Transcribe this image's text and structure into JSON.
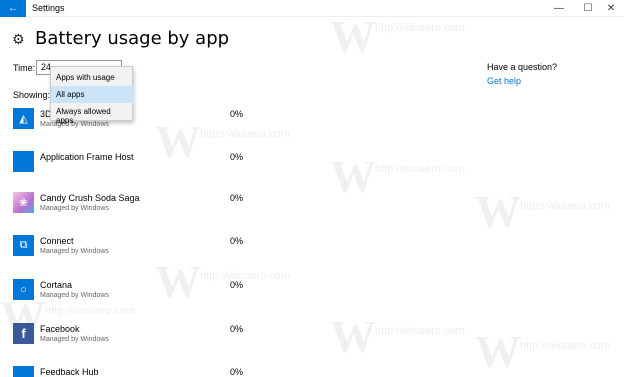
{
  "window": {
    "title": "Settings",
    "back_glyph": "←",
    "minimize_glyph": "—",
    "maximize_glyph": "☐",
    "close_glyph": "✕"
  },
  "header": {
    "title": "Battery usage by app"
  },
  "controls": {
    "time_label": "Time:",
    "time_value": "24",
    "showing_label": "Showing:"
  },
  "dropdown": {
    "options": [
      "Apps with usage",
      "All apps",
      "Always allowed apps"
    ],
    "selected": "All apps"
  },
  "help": {
    "question": "Have a question?",
    "link": "Get help"
  },
  "watermark": "http://winaero.com",
  "apps": [
    {
      "name": "3D",
      "sub": "Managed by Windows",
      "pct": "0%",
      "icon": "3d-builder-icon",
      "color": "#0078d7"
    },
    {
      "name": "Application Frame Host",
      "sub": "",
      "pct": "0%",
      "icon": "app-frame-icon",
      "color": "#0078d7"
    },
    {
      "name": "Candy Crush Soda Saga",
      "sub": "Managed by Windows",
      "pct": "0%",
      "icon": "candy-crush-icon",
      "color": "#9b59b6"
    },
    {
      "name": "Connect",
      "sub": "Managed by Windows",
      "pct": "0%",
      "icon": "connect-icon",
      "color": "#0078d7"
    },
    {
      "name": "Cortana",
      "sub": "Managed by Windows",
      "pct": "0%",
      "icon": "cortana-icon",
      "color": "#0078d7"
    },
    {
      "name": "Facebook",
      "sub": "Managed by Windows",
      "pct": "0%",
      "icon": "facebook-icon",
      "color": "#3b5998"
    },
    {
      "name": "Feedback Hub",
      "sub": "",
      "pct": "0%",
      "icon": "feedback-hub-icon",
      "color": "#0078d7"
    }
  ]
}
